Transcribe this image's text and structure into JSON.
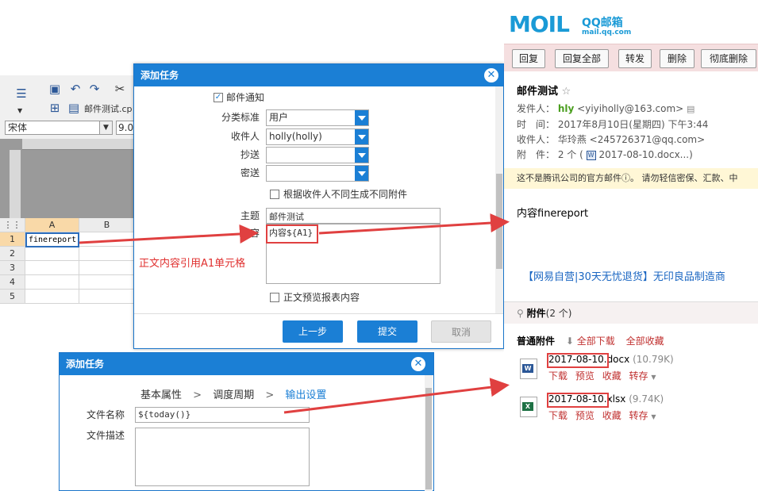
{
  "designer": {
    "font_name": "宋体",
    "font_size": "9.0",
    "report_tab": "邮件测试.cp",
    "columns": [
      "A",
      "B"
    ],
    "rows": [
      "1",
      "2",
      "3",
      "4",
      "5"
    ],
    "cell_a1": "finereport"
  },
  "dialog1": {
    "title": "添加任务",
    "email_notify": "邮件通知",
    "category_label": "分类标准",
    "category_value": "用户",
    "recipient_label": "收件人",
    "recipient_value": "holly(holly)",
    "cc_label": "抄送",
    "bcc_label": "密送",
    "per_recipient_attach": "根据收件人不同生成不同附件",
    "subject_label": "主题",
    "subject_value": "邮件测试",
    "content_label": "内容",
    "content_value": "内容${A1}",
    "annotation": "正文内容引用A1单元格",
    "preview_report": "正文预览报表内容",
    "prev_button": "上一步",
    "submit_button": "提交",
    "cancel_button": "取消"
  },
  "dialog2": {
    "title": "添加任务",
    "steps": [
      "基本属性",
      "调度周期",
      "输出设置"
    ],
    "separator": ">",
    "filename_label": "文件名称",
    "filename_value": "${today()}",
    "filedesc_label": "文件描述"
  },
  "mail": {
    "logo_letters": "MOIL",
    "brand_cn": "QQ邮箱",
    "brand_url": "mail.qq.com",
    "toolbar": [
      "回复",
      "回复全部",
      "转发",
      "删除",
      "彻底删除"
    ],
    "subject": "邮件测试",
    "star": "☆",
    "from_label": "发件人：",
    "from_name": "hly",
    "from_email": "<yiyiholly@163.com>",
    "time_label": "时　间：",
    "time_value": "2017年8月10日(星期四) 下午3:44",
    "to_label": "收件人：",
    "to_value": "华玲燕 <245726371@qq.com>",
    "attach_label": "附　件：",
    "attach_summary_count": "2 个 (",
    "attach_summary_file": "2017-08-10.docx...)",
    "warning": "这不是腾讯公司的官方邮件ⓘ。  请勿轻信密保、汇款、中",
    "body": "内容finereport",
    "ad": "【网易自营|30天无忧退货】无印良品制造商",
    "attach_header": "附件",
    "attach_count": "(2 个)",
    "normal_attach": "普通附件",
    "download_all": "全部下载",
    "save_all": "全部收藏",
    "files": [
      {
        "date": "2017-08-10",
        "ext": ".docx",
        "size": "(10.79K)"
      },
      {
        "date": "2017-08-10",
        "ext": ".xlsx",
        "size": "(9.74K)"
      }
    ],
    "file_actions": [
      "下载",
      "预览",
      "收藏",
      "转存"
    ]
  },
  "colors": {
    "dialog_blue": "#1b7fd5",
    "arrow_red": "#e04040",
    "mail_toolbar": "#f5dfe0",
    "link_blue": "#1a66c2"
  }
}
